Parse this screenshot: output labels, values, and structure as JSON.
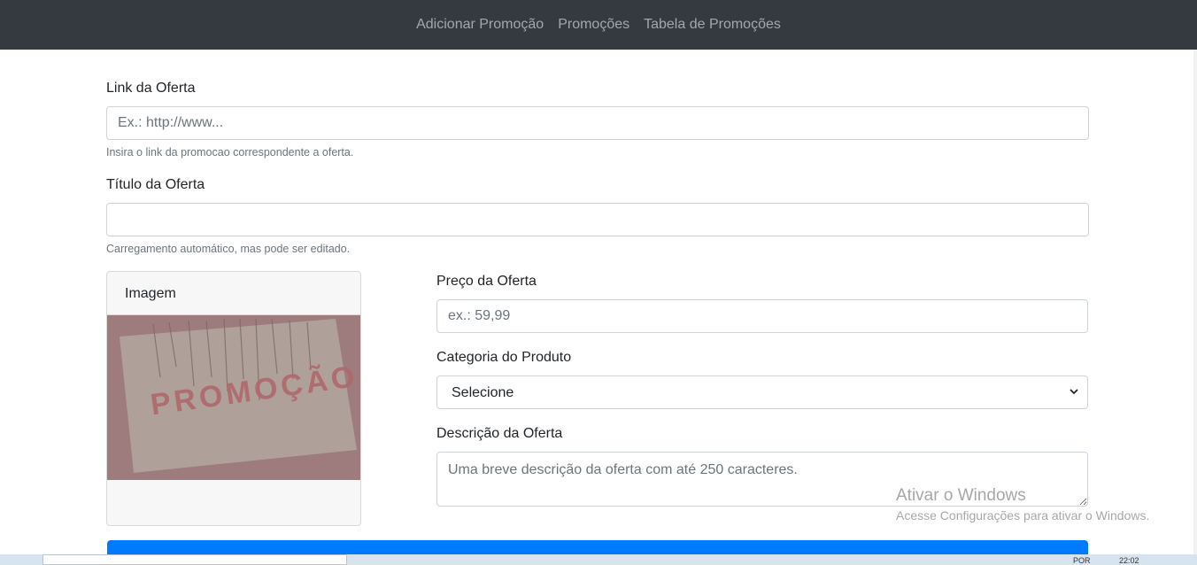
{
  "nav": {
    "items": [
      "Adicionar Promoção",
      "Promoções",
      "Tabela de Promoções"
    ]
  },
  "form": {
    "link": {
      "label": "Link da Oferta",
      "placeholder": "Ex.: http://www...",
      "help": "Insira o link da promocao correspondente a oferta."
    },
    "titulo": {
      "label": "Título da Oferta",
      "value": "",
      "help": "Carregamento automático, mas pode ser editado."
    },
    "imagem": {
      "header": "Imagem",
      "image_text": "PROMOÇÃO"
    },
    "preco": {
      "label": "Preço da Oferta",
      "placeholder": "ex.: 59,99"
    },
    "categoria": {
      "label": "Categoria do Produto",
      "selected": "Selecione"
    },
    "descricao": {
      "label": "Descrição da Oferta",
      "placeholder": "Uma breve descrição da oferta com até 250 caracteres."
    }
  },
  "watermark": {
    "title": "Ativar o Windows",
    "subtitle": "Acesse Configurações para ativar o Windows."
  },
  "taskbar": {
    "lang": "POR",
    "time": "22:02"
  },
  "colors": {
    "navbar_bg": "#343a40",
    "primary": "#007bff",
    "image_bg": "#9e7b7c"
  }
}
